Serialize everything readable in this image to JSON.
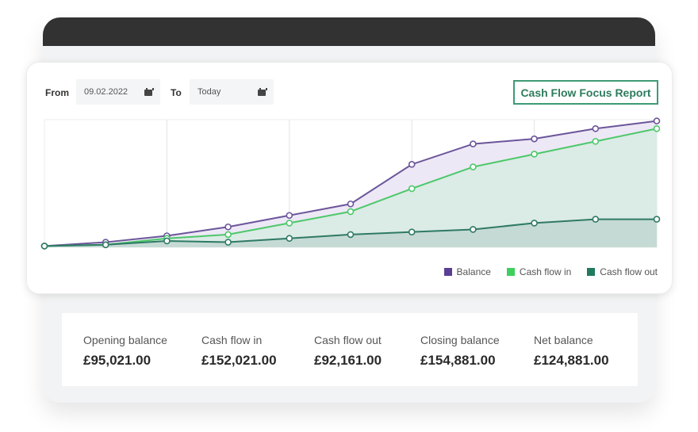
{
  "filters": {
    "from_label": "From",
    "from_value": "09.02.2022",
    "to_label": "To",
    "to_value": "Today",
    "calendar_icon": "calendar-icon"
  },
  "report_button": {
    "label": "Cash Flow Focus Report"
  },
  "colors": {
    "balance": "#6b559a",
    "balance_fill": "#ebe6f4",
    "cash_in": "#4cc86a",
    "cash_in_fill": "#d8ebe3",
    "cash_out": "#2f7a64",
    "cash_out_fill": "#c2d8d1",
    "accent": "#3e9a75",
    "titlebar": "#323232"
  },
  "chart_data": {
    "type": "area",
    "title": "",
    "xlabel": "",
    "ylabel": "",
    "x": [
      0,
      1,
      2,
      3,
      4,
      5,
      6,
      7,
      8,
      9,
      10
    ],
    "ylim": [
      0,
      100
    ],
    "grid": "vertical",
    "legend": "bottom-right",
    "series": [
      {
        "name": "Balance",
        "key": "balance",
        "values": [
          1,
          4,
          9,
          16,
          25,
          34,
          65,
          81,
          85,
          93,
          99
        ]
      },
      {
        "name": "Cash flow in",
        "key": "cash_in",
        "values": [
          1,
          2,
          7,
          10,
          19,
          28,
          46,
          63,
          73,
          83,
          93
        ]
      },
      {
        "name": "Cash flow out",
        "key": "cash_out",
        "values": [
          1,
          2,
          5,
          4,
          7,
          10,
          12,
          14,
          19,
          22,
          22
        ]
      }
    ]
  },
  "summary": [
    {
      "label": "Opening balance",
      "value": "£95,021.00"
    },
    {
      "label": "Cash flow in",
      "value": "£152,021.00"
    },
    {
      "label": "Cash flow out",
      "value": "£92,161.00"
    },
    {
      "label": "Closing balance",
      "value": "£154,881.00"
    },
    {
      "label": "Net balance",
      "value": "£124,881.00"
    }
  ]
}
